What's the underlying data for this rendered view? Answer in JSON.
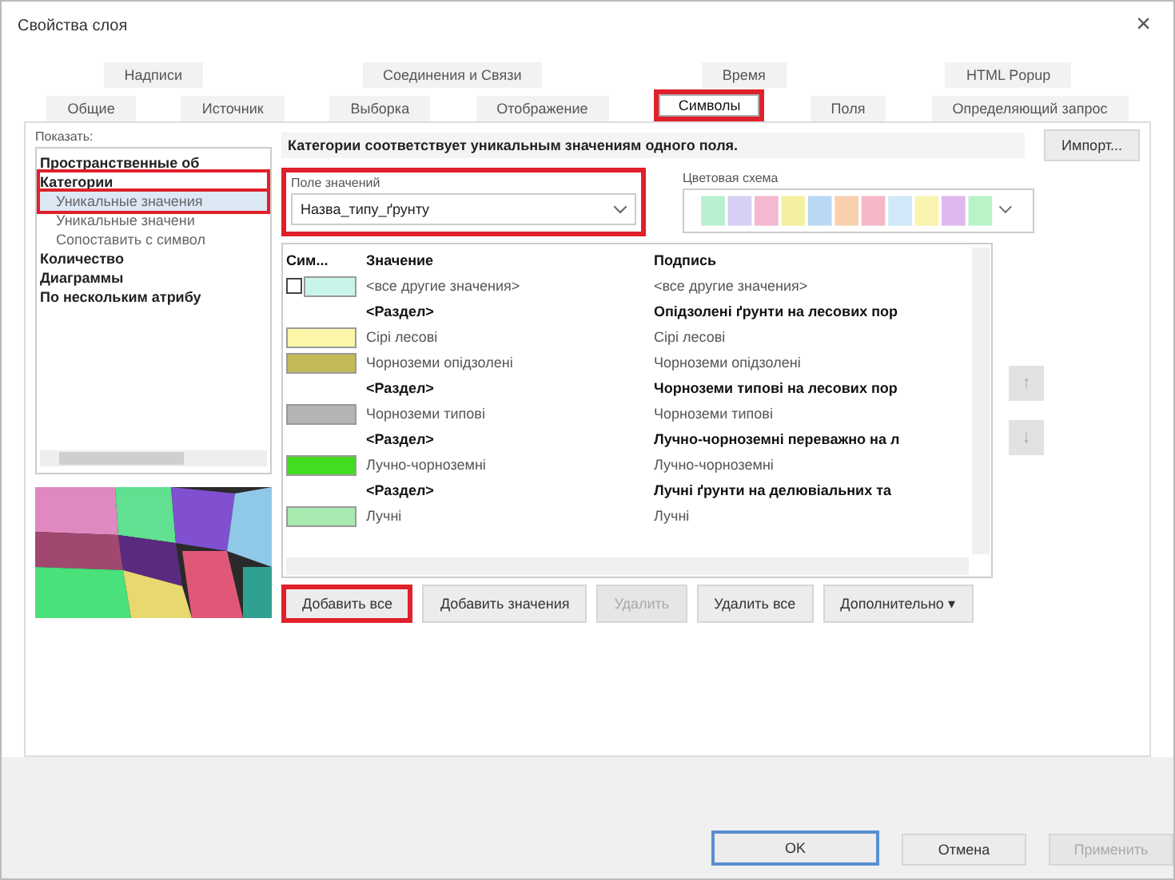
{
  "window": {
    "title": "Свойства слоя",
    "close": "×"
  },
  "tab_rows": [
    [
      {
        "label": "Надписи",
        "selected": false,
        "annotated": false
      },
      {
        "label": "Соединения и Связи",
        "selected": false,
        "annotated": false
      },
      {
        "label": "Время",
        "selected": false,
        "annotated": false
      },
      {
        "label": "HTML Popup",
        "selected": false,
        "annotated": false
      }
    ],
    [
      {
        "label": "Общие",
        "selected": false,
        "annotated": false
      },
      {
        "label": "Источник",
        "selected": false,
        "annotated": false
      },
      {
        "label": "Выборка",
        "selected": false,
        "annotated": false
      },
      {
        "label": "Отображение",
        "selected": false,
        "annotated": false
      },
      {
        "label": "Символы",
        "selected": true,
        "annotated": true
      },
      {
        "label": "Поля",
        "selected": false,
        "annotated": false
      },
      {
        "label": "Определяющий запрос",
        "selected": false,
        "annotated": false
      }
    ]
  ],
  "show": {
    "label": "Показать:",
    "items": [
      {
        "label": "Пространственные об",
        "selected": false,
        "annotated": false
      },
      {
        "label": "Категории",
        "selected": false,
        "annotated": true,
        "children": [
          {
            "label": "Уникальные значения",
            "selected": true,
            "annotated": true
          },
          {
            "label": "Уникальные значени",
            "selected": false,
            "annotated": false
          },
          {
            "label": "Сопоставить с символ",
            "selected": false,
            "annotated": false
          }
        ]
      },
      {
        "label": "Количество",
        "selected": false,
        "annotated": false
      },
      {
        "label": "Диаграммы",
        "selected": false,
        "annotated": false
      },
      {
        "label": "По нескольким атрибу",
        "selected": false,
        "annotated": false
      }
    ]
  },
  "description": "Категории соответствует уникальным значениям одного поля.",
  "import_button": "Импорт...",
  "value_field": {
    "label": "Поле значений",
    "value": "Назва_типу_ґрунту",
    "annotated": true
  },
  "color_scheme": {
    "label": "Цветовая схема"
  },
  "table": {
    "columns": [
      "Сим...",
      "Значение",
      "Подпись"
    ],
    "rows": [
      {
        "kind": "other",
        "checked": false,
        "color": "#c8f4ec",
        "value": "<все другие значения>",
        "label": "<все другие значения>"
      },
      {
        "kind": "heading",
        "value": "<Раздел>",
        "label": "Опідзолені ґрунти на лесових пор"
      },
      {
        "kind": "symbol",
        "color": "#fbf6a8",
        "value": "Сірі лесові",
        "label": "Сірі лесові"
      },
      {
        "kind": "symbol",
        "color": "#c2bb58",
        "value": "Чорноземи опідзолені",
        "label": "Чорноземи опідзолені"
      },
      {
        "kind": "heading",
        "value": "<Раздел>",
        "label": "Чорноземи типові на лесових пор"
      },
      {
        "kind": "symbol",
        "color": "#b4b4b4",
        "value": "Чорноземи типові",
        "label": "Чорноземи типові"
      },
      {
        "kind": "heading",
        "value": "<Раздел>",
        "label": "Лучно-чорноземні переважно на л"
      },
      {
        "kind": "symbol",
        "color": "#44dc22",
        "value": "Лучно-чорноземні",
        "label": "Лучно-чорноземні"
      },
      {
        "kind": "heading",
        "value": "<Раздел>",
        "label": "Лучні ґрунти на делювіальних та"
      },
      {
        "kind": "symbol",
        "color": "#a8eab0",
        "value": "Лучні",
        "label": "Лучні"
      }
    ]
  },
  "move_buttons": [
    {
      "label": "↑",
      "disabled": true
    },
    {
      "label": "↓",
      "disabled": true
    }
  ],
  "actions": [
    {
      "label": "Добавить все",
      "disabled": false,
      "annotated": true
    },
    {
      "label": "Добавить значения",
      "disabled": false,
      "annotated": false
    },
    {
      "label": "Удалить",
      "disabled": true,
      "annotated": false
    },
    {
      "label": "Удалить все",
      "disabled": false,
      "annotated": false
    },
    {
      "label": "Дополнительно",
      "disabled": false,
      "annotated": false,
      "caret": "▾"
    }
  ],
  "footer": [
    {
      "label": "OK",
      "default": true,
      "disabled": false
    },
    {
      "label": "Отмена",
      "default": false,
      "disabled": false
    },
    {
      "label": "Применить",
      "default": false,
      "disabled": true
    }
  ]
}
